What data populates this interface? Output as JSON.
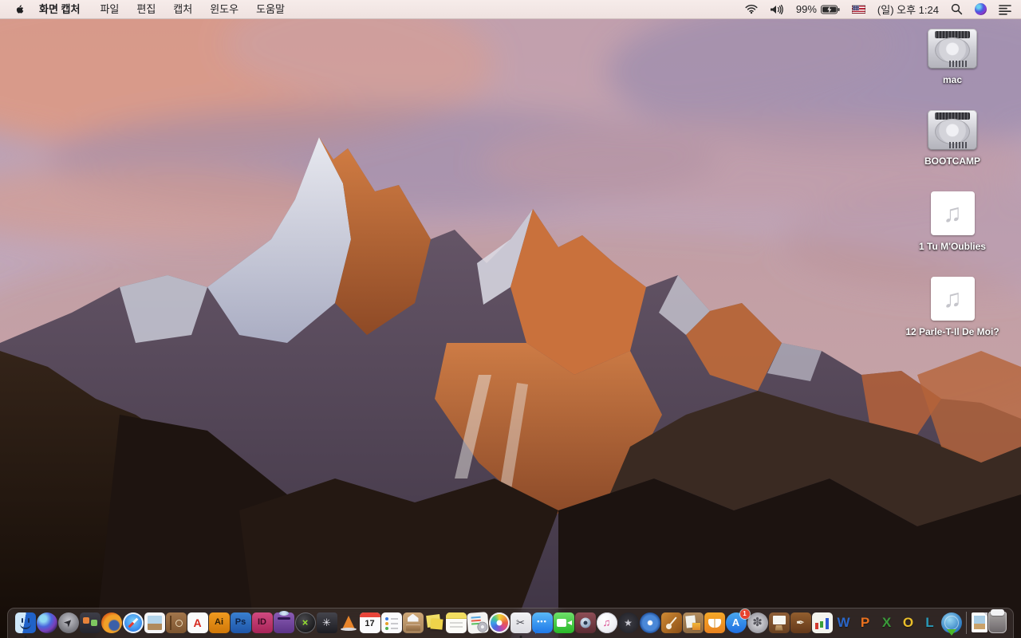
{
  "theme": {
    "menubar_bg": "#f4e9e6",
    "menubar_text": "#1f1f21",
    "dock_bg": "rgba(68,58,56,0.5)",
    "badge_red": "#e8432e",
    "desktop_label_color": "#ffffff"
  },
  "menu_bar": {
    "apple_logo_icon": "apple-icon",
    "menus": [
      {
        "id": "app",
        "label": "화면 캡처",
        "bold": true
      },
      {
        "id": "file",
        "label": "파일"
      },
      {
        "id": "edit",
        "label": "편집"
      },
      {
        "id": "capture",
        "label": "캡처"
      },
      {
        "id": "window",
        "label": "윈도우"
      },
      {
        "id": "help",
        "label": "도움말"
      }
    ],
    "status": {
      "icons": [
        "wifi-icon",
        "volume-icon",
        "battery-charging-icon",
        "input-source-us-flag-icon",
        "spotlight-search-icon",
        "siri-icon",
        "notification-center-icon"
      ],
      "battery_percent": "99%",
      "clock": "(일) 오후 1:24"
    }
  },
  "desktop": {
    "audio_glyph": "♫",
    "icons": [
      {
        "name": "mac",
        "type": "hard-drive",
        "label": "mac"
      },
      {
        "name": "bootcamp",
        "type": "hard-drive",
        "label": "BOOTCAMP"
      },
      {
        "name": "tu-moublies",
        "type": "audio-file",
        "label": "1 Tu M'Oublies"
      },
      {
        "name": "parle-t-il-de-moi",
        "type": "audio-file",
        "label": "12 Parle-T-Il De Moi?"
      }
    ]
  },
  "dock": {
    "items": [
      {
        "name": "finder",
        "kind": "finder",
        "running": true
      },
      {
        "name": "siri",
        "kind": "siri"
      },
      {
        "name": "launchpad",
        "kind": "launchpad",
        "glyph": "➤"
      },
      {
        "name": "mission-control",
        "kind": "mission"
      },
      {
        "name": "firefox",
        "kind": "firefox"
      },
      {
        "name": "safari",
        "kind": "safari"
      },
      {
        "name": "preview",
        "kind": "preview"
      },
      {
        "name": "contacts",
        "kind": "contacts"
      },
      {
        "name": "acrobat-reader",
        "kind": "acrobat",
        "glyph": "A"
      },
      {
        "name": "illustrator",
        "kind": "ai",
        "glyph": "Ai"
      },
      {
        "name": "photoshop",
        "kind": "ps",
        "glyph": "Ps"
      },
      {
        "name": "indesign",
        "kind": "id",
        "glyph": "ID"
      },
      {
        "name": "toast-titanium",
        "kind": "toast"
      },
      {
        "name": "divx",
        "kind": "divx",
        "glyph": "×"
      },
      {
        "name": "disk-tool",
        "kind": "fandisk",
        "glyph": "✳"
      },
      {
        "name": "vlc",
        "kind": "vlc"
      },
      {
        "name": "calendar",
        "kind": "calendar",
        "glyph": "17"
      },
      {
        "name": "reminders",
        "kind": "reminders"
      },
      {
        "name": "archive-utility",
        "kind": "archive"
      },
      {
        "name": "stickies",
        "kind": "stickies"
      },
      {
        "name": "notes",
        "kind": "notes"
      },
      {
        "name": "installer-documents",
        "kind": "docsdisc"
      },
      {
        "name": "photos",
        "kind": "photos"
      },
      {
        "name": "screen-capture-grab",
        "kind": "grab",
        "glyph": "✂",
        "running": true
      },
      {
        "name": "messages",
        "kind": "messages",
        "glyph": "•••"
      },
      {
        "name": "facetime",
        "kind": "facetime"
      },
      {
        "name": "photo-booth",
        "kind": "photobooth"
      },
      {
        "name": "itunes",
        "kind": "itunes",
        "glyph": "♫"
      },
      {
        "name": "imovie",
        "kind": "imovie",
        "glyph": "★"
      },
      {
        "name": "dvd-player",
        "kind": "dvd"
      },
      {
        "name": "garageband",
        "kind": "garageband"
      },
      {
        "name": "news-collage-app",
        "kind": "collage"
      },
      {
        "name": "ibooks",
        "kind": "ibooks"
      },
      {
        "name": "app-store",
        "kind": "appstore",
        "glyph": "A",
        "badge": "1"
      },
      {
        "name": "system-preferences",
        "kind": "sysprefs",
        "glyph": "✽"
      },
      {
        "name": "keynote-09",
        "kind": "keynote"
      },
      {
        "name": "pages-09",
        "kind": "pages09",
        "glyph": "✒"
      },
      {
        "name": "office-chart-tool",
        "kind": "officechart"
      },
      {
        "name": "microsoft-word",
        "kind": "letter word",
        "glyph": "W"
      },
      {
        "name": "microsoft-powerpoint",
        "kind": "letter ppt",
        "glyph": "P"
      },
      {
        "name": "microsoft-excel",
        "kind": "letter excel",
        "glyph": "X"
      },
      {
        "name": "microsoft-outlook",
        "kind": "letter outlook",
        "glyph": "O"
      },
      {
        "name": "microsoft-lync",
        "kind": "letter lync",
        "glyph": "L"
      },
      {
        "name": "download-manager",
        "kind": "downloadglobe"
      },
      {
        "kind": "separator"
      },
      {
        "name": "downloads-stack",
        "kind": "downloadsdoc"
      },
      {
        "name": "trash",
        "kind": "trash"
      }
    ]
  }
}
